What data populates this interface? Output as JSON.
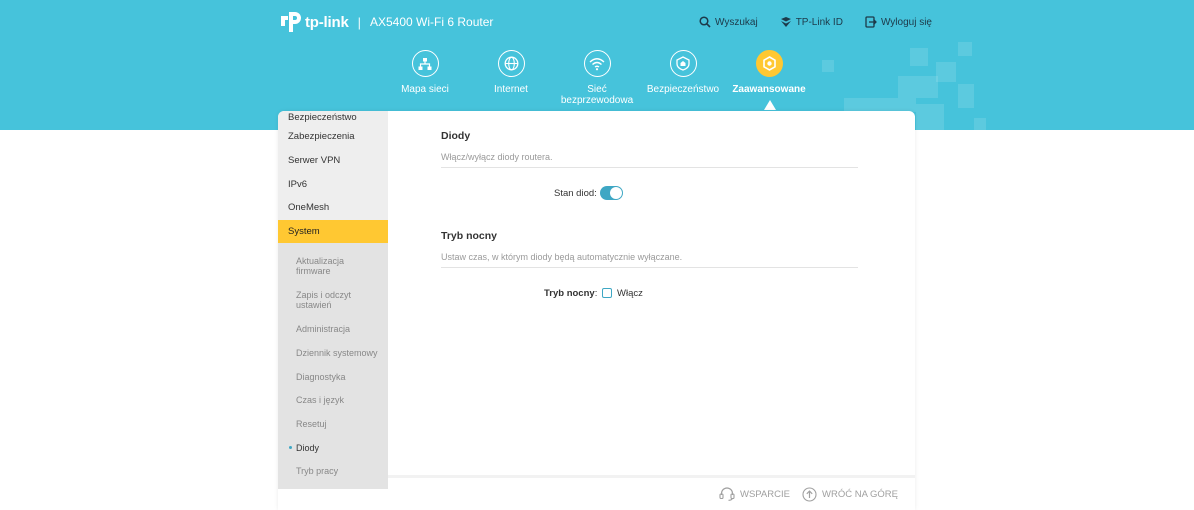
{
  "brand": {
    "logo_text": "tp-link",
    "separator": "|",
    "model": "AX5400 Wi-Fi 6 Router"
  },
  "top_actions": [
    {
      "label": "Wyszukaj",
      "icon": "search-icon"
    },
    {
      "label": "TP-Link ID",
      "icon": "tplink-id-icon"
    },
    {
      "label": "Wyloguj się",
      "icon": "logout-icon"
    }
  ],
  "nav": [
    {
      "label": "Mapa sieci",
      "icon": "network-map-icon"
    },
    {
      "label": "Internet",
      "icon": "globe-icon"
    },
    {
      "label": "Sieć bezprzewodowa",
      "icon": "wifi-icon"
    },
    {
      "label": "Bezpieczeństwo",
      "icon": "shield-home-icon"
    },
    {
      "label": "Zaawansowane",
      "icon": "gear-icon",
      "active": true
    }
  ],
  "sidebar": {
    "items": [
      {
        "label": "Bezpieczeństwo"
      },
      {
        "label": "Zabezpieczenia"
      },
      {
        "label": "Serwer VPN"
      },
      {
        "label": "IPv6"
      },
      {
        "label": "OneMesh"
      },
      {
        "label": "System",
        "active": true
      }
    ],
    "submenu": [
      {
        "label": "Aktualizacja firmware"
      },
      {
        "label": "Zapis i odczyt ustawień"
      },
      {
        "label": "Administracja"
      },
      {
        "label": "Dziennik systemowy"
      },
      {
        "label": "Diagnostyka"
      },
      {
        "label": "Czas i język"
      },
      {
        "label": "Resetuj"
      },
      {
        "label": "Diody",
        "active": true
      },
      {
        "label": "Tryb pracy"
      }
    ]
  },
  "content": {
    "leds": {
      "title": "Diody",
      "description": "Włącz/wyłącz diody routera.",
      "status_label": "Stan diod:",
      "status_on": true
    },
    "night_mode": {
      "title": "Tryb nocny",
      "description": "Ustaw czas, w którym diody będą automatycznie wyłączane.",
      "label": "Tryb nocny",
      "colon": ":",
      "checkbox_label": "Włącz",
      "enabled": false
    }
  },
  "footer": {
    "support_label": "WSPARCIE",
    "top_label": "WRÓĆ NA GÓRĘ"
  },
  "colors": {
    "header_bg": "#46c3db",
    "accent_yellow": "#ffc832",
    "toggle_blue": "#3ea7c4"
  }
}
